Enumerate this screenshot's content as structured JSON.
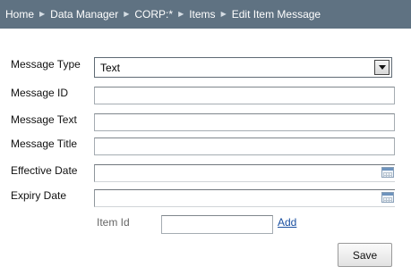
{
  "breadcrumb": {
    "items": [
      "Home",
      "Data Manager",
      "CORP:*",
      "Items",
      "Edit Item Message"
    ],
    "separator": "▶"
  },
  "form": {
    "message_type": {
      "label": "Message Type",
      "value": "Text"
    },
    "message_id": {
      "label": "Message ID",
      "value": ""
    },
    "message_text": {
      "label": "Message Text",
      "value": ""
    },
    "message_title": {
      "label": "Message Title",
      "value": ""
    },
    "effective_date": {
      "label": "Effective Date",
      "value": ""
    },
    "expiry_date": {
      "label": "Expiry Date",
      "value": ""
    },
    "item_id": {
      "label": "Item Id",
      "value": "",
      "add_label": "Add"
    }
  },
  "actions": {
    "save_label": "Save"
  },
  "colors": {
    "breadcrumb_bg": "#5f7282",
    "link": "#1a4fa0"
  },
  "icons": {
    "select_arrow": "chevron-down-icon",
    "date_picker": "calendar-icon"
  }
}
